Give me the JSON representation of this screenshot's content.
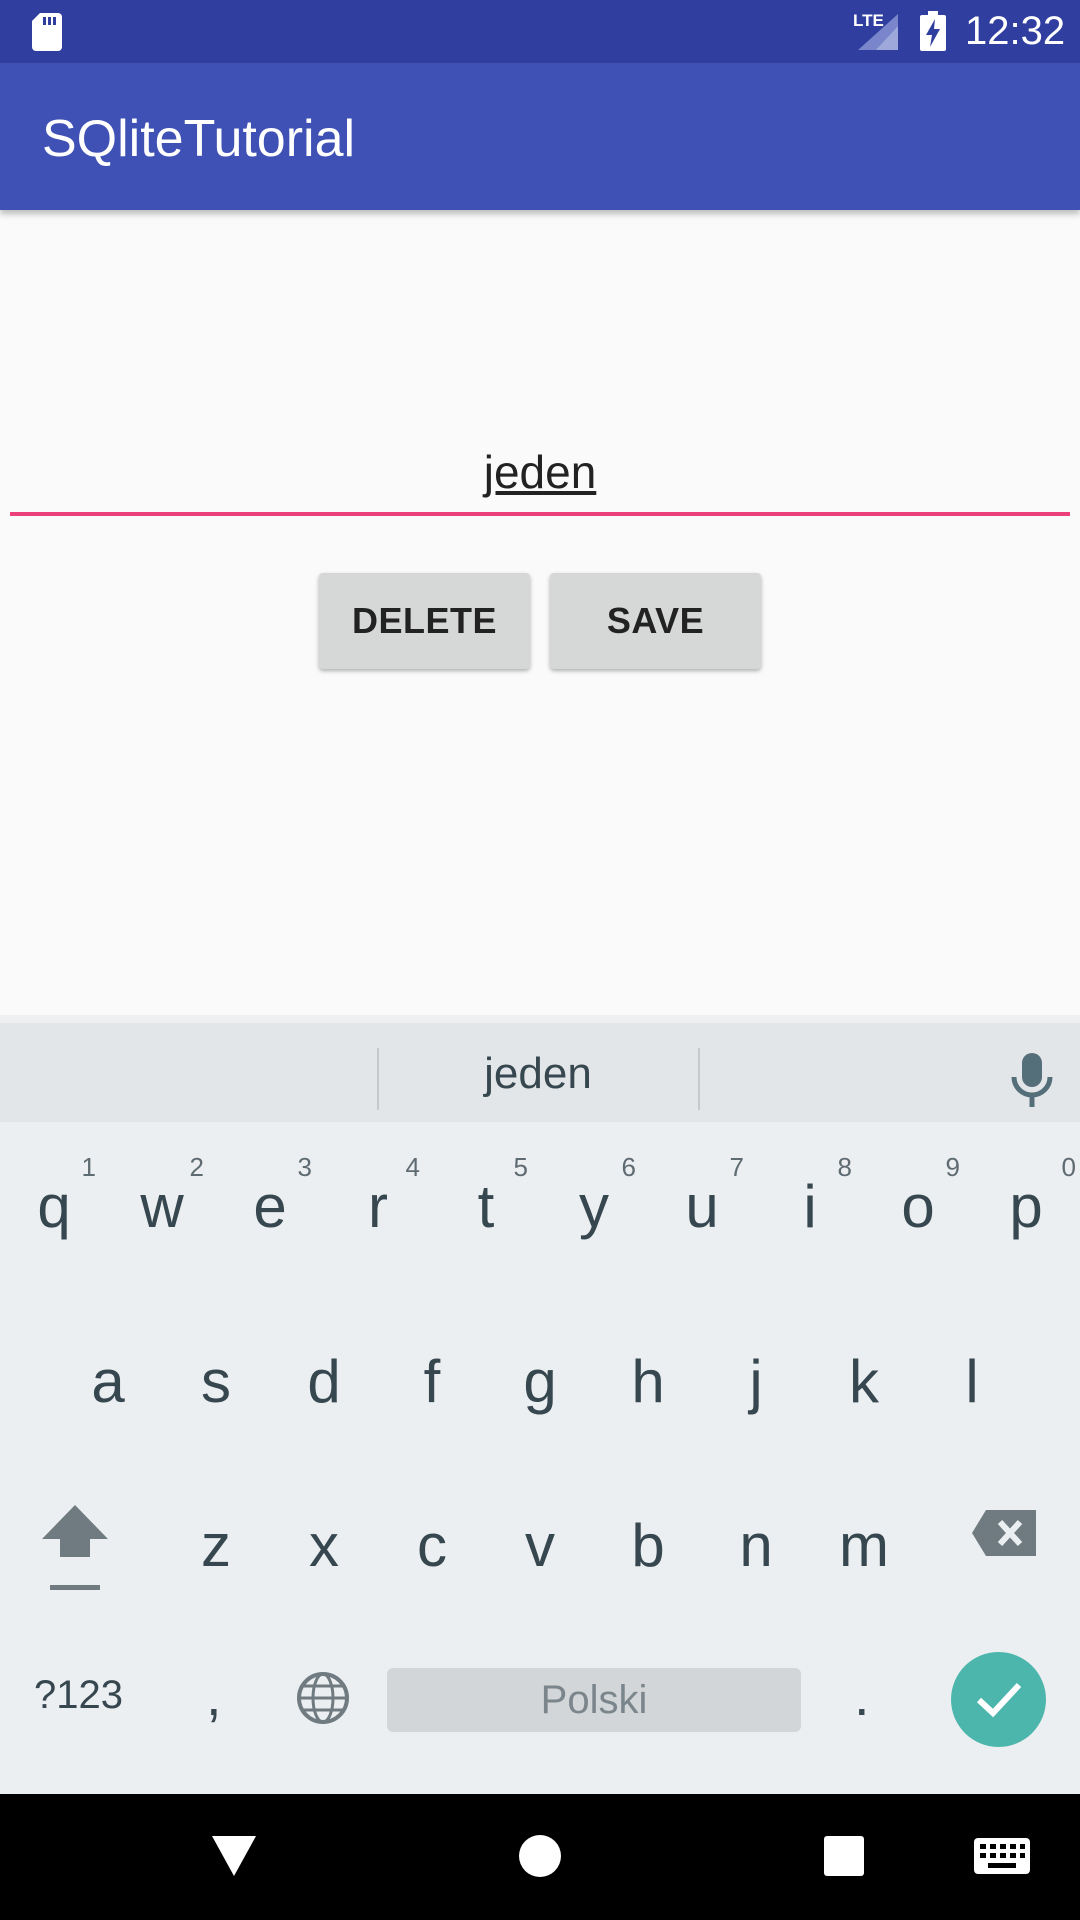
{
  "status_bar": {
    "network_label": "LTE",
    "time": "12:32"
  },
  "app_bar": {
    "title": "SQliteTutorial"
  },
  "main": {
    "edit_value": "jeden",
    "delete_label": "DELETE",
    "save_label": "SAVE",
    "accent_color": "#ec407a"
  },
  "keyboard": {
    "suggestion": "jeden",
    "row1": [
      {
        "ch": "q",
        "hint": "1"
      },
      {
        "ch": "w",
        "hint": "2"
      },
      {
        "ch": "e",
        "hint": "3"
      },
      {
        "ch": "r",
        "hint": "4"
      },
      {
        "ch": "t",
        "hint": "5"
      },
      {
        "ch": "y",
        "hint": "6"
      },
      {
        "ch": "u",
        "hint": "7"
      },
      {
        "ch": "i",
        "hint": "8"
      },
      {
        "ch": "o",
        "hint": "9"
      },
      {
        "ch": "p",
        "hint": "0"
      }
    ],
    "row2": [
      "a",
      "s",
      "d",
      "f",
      "g",
      "h",
      "j",
      "k",
      "l"
    ],
    "row3": [
      "z",
      "x",
      "c",
      "v",
      "b",
      "n",
      "m"
    ],
    "symbols_label": "?123",
    "comma_label": ",",
    "space_label": "Polski",
    "period_label": ".",
    "icons": [
      "shift-icon",
      "backspace-icon",
      "globe-icon",
      "mic-icon",
      "checkmark-icon"
    ]
  },
  "nav_bar": {
    "icons": [
      "back-icon",
      "home-icon",
      "recents-icon",
      "keyboard-icon"
    ]
  },
  "colors": {
    "status_bar": "#303f9f",
    "app_bar": "#3f51b5",
    "enter_key": "#4db6ac"
  }
}
